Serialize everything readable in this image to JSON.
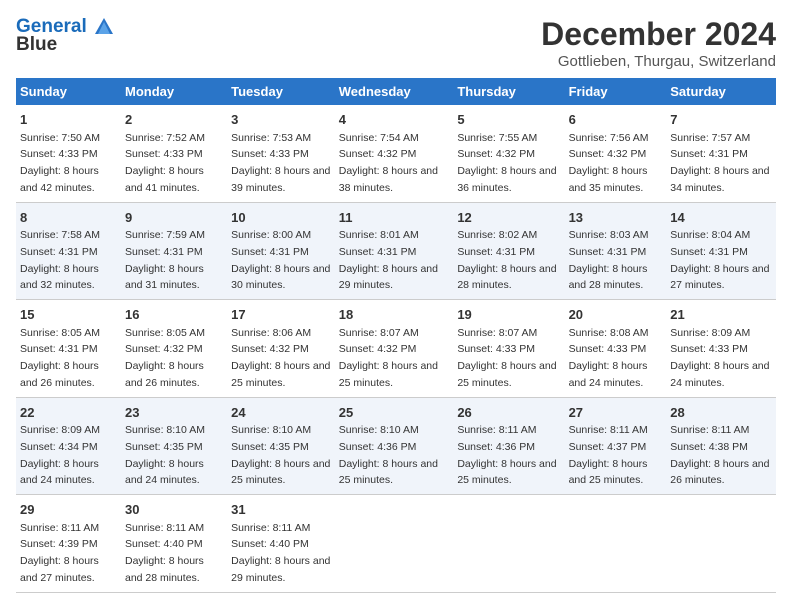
{
  "header": {
    "logo_line1": "General",
    "logo_line2": "Blue",
    "month": "December 2024",
    "location": "Gottlieben, Thurgau, Switzerland"
  },
  "days_of_week": [
    "Sunday",
    "Monday",
    "Tuesday",
    "Wednesday",
    "Thursday",
    "Friday",
    "Saturday"
  ],
  "weeks": [
    [
      {
        "day": "1",
        "sunrise": "Sunrise: 7:50 AM",
        "sunset": "Sunset: 4:33 PM",
        "daylight": "Daylight: 8 hours and 42 minutes."
      },
      {
        "day": "2",
        "sunrise": "Sunrise: 7:52 AM",
        "sunset": "Sunset: 4:33 PM",
        "daylight": "Daylight: 8 hours and 41 minutes."
      },
      {
        "day": "3",
        "sunrise": "Sunrise: 7:53 AM",
        "sunset": "Sunset: 4:33 PM",
        "daylight": "Daylight: 8 hours and 39 minutes."
      },
      {
        "day": "4",
        "sunrise": "Sunrise: 7:54 AM",
        "sunset": "Sunset: 4:32 PM",
        "daylight": "Daylight: 8 hours and 38 minutes."
      },
      {
        "day": "5",
        "sunrise": "Sunrise: 7:55 AM",
        "sunset": "Sunset: 4:32 PM",
        "daylight": "Daylight: 8 hours and 36 minutes."
      },
      {
        "day": "6",
        "sunrise": "Sunrise: 7:56 AM",
        "sunset": "Sunset: 4:32 PM",
        "daylight": "Daylight: 8 hours and 35 minutes."
      },
      {
        "day": "7",
        "sunrise": "Sunrise: 7:57 AM",
        "sunset": "Sunset: 4:31 PM",
        "daylight": "Daylight: 8 hours and 34 minutes."
      }
    ],
    [
      {
        "day": "8",
        "sunrise": "Sunrise: 7:58 AM",
        "sunset": "Sunset: 4:31 PM",
        "daylight": "Daylight: 8 hours and 32 minutes."
      },
      {
        "day": "9",
        "sunrise": "Sunrise: 7:59 AM",
        "sunset": "Sunset: 4:31 PM",
        "daylight": "Daylight: 8 hours and 31 minutes."
      },
      {
        "day": "10",
        "sunrise": "Sunrise: 8:00 AM",
        "sunset": "Sunset: 4:31 PM",
        "daylight": "Daylight: 8 hours and 30 minutes."
      },
      {
        "day": "11",
        "sunrise": "Sunrise: 8:01 AM",
        "sunset": "Sunset: 4:31 PM",
        "daylight": "Daylight: 8 hours and 29 minutes."
      },
      {
        "day": "12",
        "sunrise": "Sunrise: 8:02 AM",
        "sunset": "Sunset: 4:31 PM",
        "daylight": "Daylight: 8 hours and 28 minutes."
      },
      {
        "day": "13",
        "sunrise": "Sunrise: 8:03 AM",
        "sunset": "Sunset: 4:31 PM",
        "daylight": "Daylight: 8 hours and 28 minutes."
      },
      {
        "day": "14",
        "sunrise": "Sunrise: 8:04 AM",
        "sunset": "Sunset: 4:31 PM",
        "daylight": "Daylight: 8 hours and 27 minutes."
      }
    ],
    [
      {
        "day": "15",
        "sunrise": "Sunrise: 8:05 AM",
        "sunset": "Sunset: 4:31 PM",
        "daylight": "Daylight: 8 hours and 26 minutes."
      },
      {
        "day": "16",
        "sunrise": "Sunrise: 8:05 AM",
        "sunset": "Sunset: 4:32 PM",
        "daylight": "Daylight: 8 hours and 26 minutes."
      },
      {
        "day": "17",
        "sunrise": "Sunrise: 8:06 AM",
        "sunset": "Sunset: 4:32 PM",
        "daylight": "Daylight: 8 hours and 25 minutes."
      },
      {
        "day": "18",
        "sunrise": "Sunrise: 8:07 AM",
        "sunset": "Sunset: 4:32 PM",
        "daylight": "Daylight: 8 hours and 25 minutes."
      },
      {
        "day": "19",
        "sunrise": "Sunrise: 8:07 AM",
        "sunset": "Sunset: 4:33 PM",
        "daylight": "Daylight: 8 hours and 25 minutes."
      },
      {
        "day": "20",
        "sunrise": "Sunrise: 8:08 AM",
        "sunset": "Sunset: 4:33 PM",
        "daylight": "Daylight: 8 hours and 24 minutes."
      },
      {
        "day": "21",
        "sunrise": "Sunrise: 8:09 AM",
        "sunset": "Sunset: 4:33 PM",
        "daylight": "Daylight: 8 hours and 24 minutes."
      }
    ],
    [
      {
        "day": "22",
        "sunrise": "Sunrise: 8:09 AM",
        "sunset": "Sunset: 4:34 PM",
        "daylight": "Daylight: 8 hours and 24 minutes."
      },
      {
        "day": "23",
        "sunrise": "Sunrise: 8:10 AM",
        "sunset": "Sunset: 4:35 PM",
        "daylight": "Daylight: 8 hours and 24 minutes."
      },
      {
        "day": "24",
        "sunrise": "Sunrise: 8:10 AM",
        "sunset": "Sunset: 4:35 PM",
        "daylight": "Daylight: 8 hours and 25 minutes."
      },
      {
        "day": "25",
        "sunrise": "Sunrise: 8:10 AM",
        "sunset": "Sunset: 4:36 PM",
        "daylight": "Daylight: 8 hours and 25 minutes."
      },
      {
        "day": "26",
        "sunrise": "Sunrise: 8:11 AM",
        "sunset": "Sunset: 4:36 PM",
        "daylight": "Daylight: 8 hours and 25 minutes."
      },
      {
        "day": "27",
        "sunrise": "Sunrise: 8:11 AM",
        "sunset": "Sunset: 4:37 PM",
        "daylight": "Daylight: 8 hours and 25 minutes."
      },
      {
        "day": "28",
        "sunrise": "Sunrise: 8:11 AM",
        "sunset": "Sunset: 4:38 PM",
        "daylight": "Daylight: 8 hours and 26 minutes."
      }
    ],
    [
      {
        "day": "29",
        "sunrise": "Sunrise: 8:11 AM",
        "sunset": "Sunset: 4:39 PM",
        "daylight": "Daylight: 8 hours and 27 minutes."
      },
      {
        "day": "30",
        "sunrise": "Sunrise: 8:11 AM",
        "sunset": "Sunset: 4:40 PM",
        "daylight": "Daylight: 8 hours and 28 minutes."
      },
      {
        "day": "31",
        "sunrise": "Sunrise: 8:11 AM",
        "sunset": "Sunset: 4:40 PM",
        "daylight": "Daylight: 8 hours and 29 minutes."
      },
      null,
      null,
      null,
      null
    ]
  ]
}
